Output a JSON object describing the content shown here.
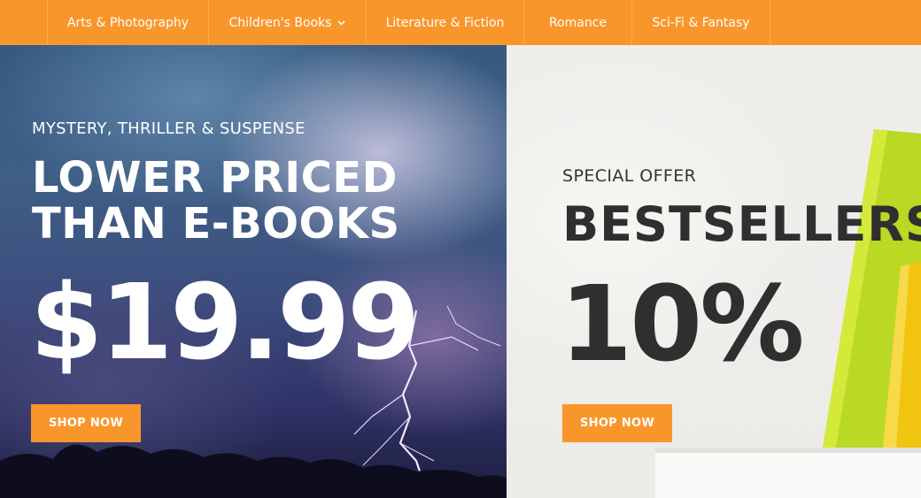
{
  "nav": {
    "items": [
      {
        "label": "Arts & Photography",
        "has_dropdown": false
      },
      {
        "label": "Children's Books",
        "has_dropdown": true,
        "icon": "chevron-down-icon"
      },
      {
        "label": "Literature & Fiction",
        "has_dropdown": false
      },
      {
        "label": "Romance",
        "has_dropdown": false
      },
      {
        "label": "Sci-Fi & Fantasy",
        "has_dropdown": false
      }
    ]
  },
  "banner_left": {
    "subtitle": "MYSTERY, THRILLER & SUSPENSE",
    "headline_line1": "LOWER PRICED",
    "headline_line2": "THAN E-BOOKS",
    "price": "$19.99",
    "button_label": "SHOP NOW"
  },
  "banner_right": {
    "subtitle": "SPECIAL OFFER",
    "headline": "BESTSELLERS",
    "discount": "10%",
    "button_label": "SHOP NOW"
  },
  "colors": {
    "accent": "#f9962b",
    "dark_text": "#2f2f2f",
    "light_text": "#ffffff"
  }
}
